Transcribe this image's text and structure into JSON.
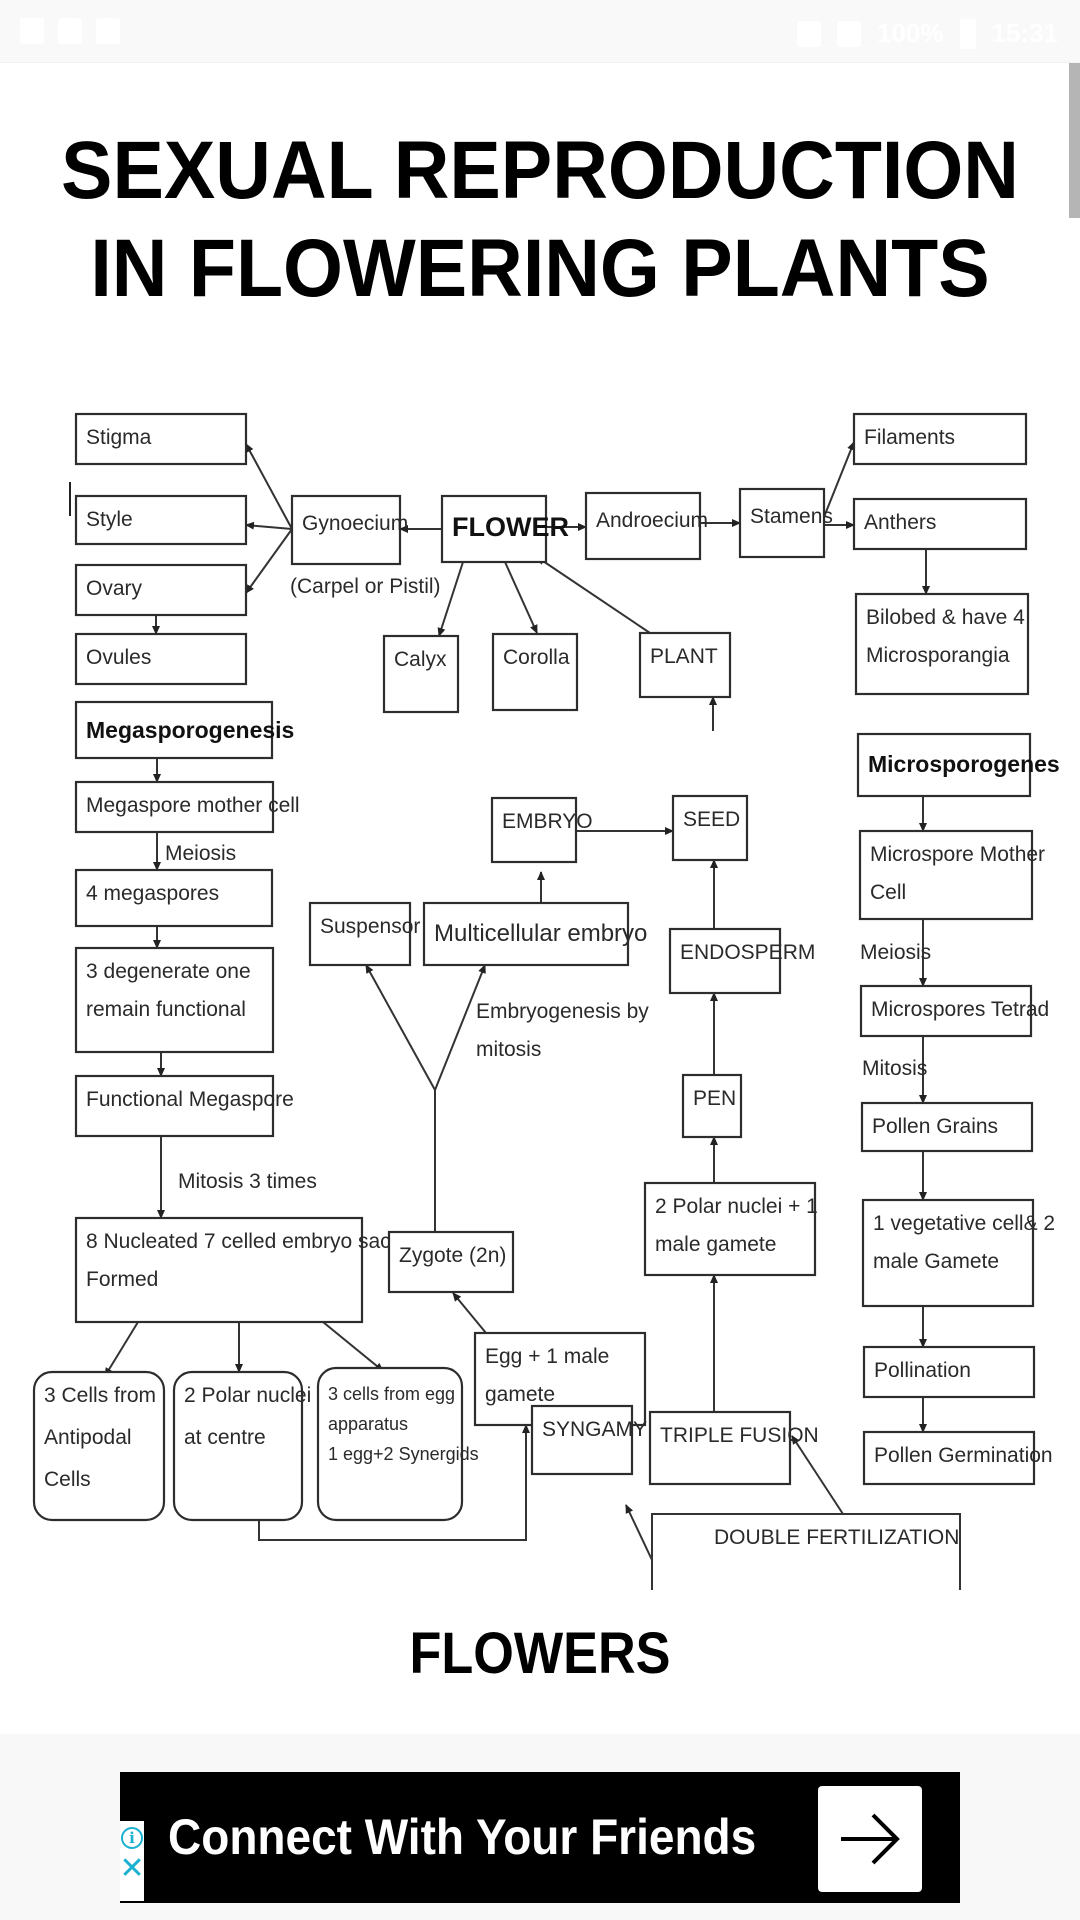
{
  "status_bar": {
    "battery": "100%",
    "time": "15:31"
  },
  "page": {
    "title_lines": [
      "SEXUAL REPRODUCTION",
      "IN FLOWERING PLANTS"
    ],
    "section_title": "FLOWERS"
  },
  "diagram": {
    "title": "Sexual reproduction in flowering plants flowchart",
    "nodes": [
      {
        "id": "stigma",
        "lines": [
          "Stigma"
        ]
      },
      {
        "id": "style",
        "lines": [
          "Style"
        ]
      },
      {
        "id": "ovary",
        "lines": [
          "Ovary"
        ]
      },
      {
        "id": "ovules",
        "lines": [
          "Ovules"
        ]
      },
      {
        "id": "gynoecium",
        "lines": [
          "Gynoecium"
        ]
      },
      {
        "id": "flower",
        "lines": [
          "FLOWER"
        ]
      },
      {
        "id": "androecium",
        "lines": [
          "Androecium"
        ]
      },
      {
        "id": "stamens",
        "lines": [
          "Stamens"
        ]
      },
      {
        "id": "filaments",
        "lines": [
          "Filaments"
        ]
      },
      {
        "id": "anthers",
        "lines": [
          "Anthers"
        ]
      },
      {
        "id": "bilobed",
        "lines": [
          "Bilobed & have 4",
          "Microsporangia"
        ]
      },
      {
        "id": "calyx",
        "lines": [
          "Calyx"
        ]
      },
      {
        "id": "corolla",
        "lines": [
          "Corolla"
        ]
      },
      {
        "id": "plant",
        "lines": [
          "PLANT"
        ]
      },
      {
        "id": "megasporogenesis",
        "lines": [
          "Megasporogenesis"
        ]
      },
      {
        "id": "megaspore_mother_cell",
        "lines": [
          "Megaspore mother cell"
        ]
      },
      {
        "id": "four_megaspores",
        "lines": [
          "4 megaspores"
        ]
      },
      {
        "id": "three_degenerate",
        "lines": [
          "3 degenerate one",
          "remain functional"
        ]
      },
      {
        "id": "functional_megaspore",
        "lines": [
          "Functional Megaspore"
        ]
      },
      {
        "id": "embryo_sac",
        "lines": [
          "8 Nucleated 7 celled embryo sac",
          "Formed"
        ]
      },
      {
        "id": "antipodal",
        "lines": [
          "3 Cells from",
          "Antipodal",
          "Cells"
        ]
      },
      {
        "id": "polar_centre",
        "lines": [
          "2 Polar nuclei",
          "at centre"
        ]
      },
      {
        "id": "egg_apparatus",
        "lines": [
          "3 cells from egg",
          "apparatus",
          "1 egg+2 Synergids"
        ]
      },
      {
        "id": "embryo",
        "lines": [
          "EMBRYO"
        ]
      },
      {
        "id": "seed",
        "lines": [
          "SEED"
        ]
      },
      {
        "id": "suspensor",
        "lines": [
          "Suspensor"
        ]
      },
      {
        "id": "multicellular_embryo",
        "lines": [
          "Multicellular embryo"
        ]
      },
      {
        "id": "endosperm",
        "lines": [
          "ENDOSPERM"
        ]
      },
      {
        "id": "pen",
        "lines": [
          "PEN"
        ]
      },
      {
        "id": "polar_male",
        "lines": [
          "2 Polar nuclei + 1",
          "male gamete"
        ]
      },
      {
        "id": "zygote",
        "lines": [
          "Zygote (2n)"
        ]
      },
      {
        "id": "egg_male",
        "lines": [
          "Egg + 1 male",
          "gamete"
        ]
      },
      {
        "id": "syngamy",
        "lines": [
          "SYNGAMY"
        ]
      },
      {
        "id": "triple_fusion",
        "lines": [
          "TRIPLE FUSION"
        ]
      },
      {
        "id": "double_fertilization",
        "lines": [
          "DOUBLE FERTILIZATION"
        ]
      },
      {
        "id": "microsporogenes",
        "lines": [
          "Microsporogenes"
        ]
      },
      {
        "id": "microspore_mother_cell",
        "lines": [
          "Microspore Mother",
          "Cell"
        ]
      },
      {
        "id": "microspores_tetrad",
        "lines": [
          "Microspores Tetrad"
        ]
      },
      {
        "id": "pollen_grains",
        "lines": [
          "Pollen Grains"
        ]
      },
      {
        "id": "vegetative_cell",
        "lines": [
          "1 vegetative cell& 2",
          "male Gamete"
        ]
      },
      {
        "id": "pollination",
        "lines": [
          "Pollination"
        ]
      },
      {
        "id": "pollen_germination",
        "lines": [
          "Pollen Germination"
        ]
      }
    ],
    "annotations": {
      "carpel": "(Carpel or Pistil)",
      "meiosis_left": "Meiosis",
      "mitosis_3_times": "Mitosis 3 times",
      "embryogenesis_1": "Embryogenesis by",
      "embryogenesis_2": "mitosis",
      "meiosis_right": "Meiosis",
      "mitosis_right": "Mitosis"
    },
    "edges": [
      {
        "from": "flower",
        "to": "gynoecium"
      },
      {
        "from": "gynoecium",
        "to": "stigma"
      },
      {
        "from": "gynoecium",
        "to": "style"
      },
      {
        "from": "gynoecium",
        "to": "ovary"
      },
      {
        "from": "ovary",
        "to": "ovules"
      },
      {
        "from": "flower",
        "to": "androecium"
      },
      {
        "from": "androecium",
        "to": "stamens"
      },
      {
        "from": "stamens",
        "to": "filaments"
      },
      {
        "from": "stamens",
        "to": "anthers"
      },
      {
        "from": "anthers",
        "to": "bilobed"
      },
      {
        "from": "flower",
        "to": "calyx"
      },
      {
        "from": "flower",
        "to": "corolla"
      },
      {
        "from": "plant",
        "to": "flower"
      },
      {
        "from": "seed",
        "to": "plant"
      },
      {
        "from": "embryo",
        "to": "seed"
      },
      {
        "from": "endosperm",
        "to": "seed"
      },
      {
        "from": "pen",
        "to": "endosperm"
      },
      {
        "from": "polar_male",
        "to": "pen"
      },
      {
        "from": "triple_fusion",
        "to": "polar_male"
      },
      {
        "from": "multicellular_embryo",
        "to": "embryo"
      },
      {
        "from": "zygote",
        "to": "suspensor"
      },
      {
        "from": "zygote",
        "to": "multicellular_embryo"
      },
      {
        "from": "egg_male",
        "to": "zygote"
      },
      {
        "from": "syngamy",
        "to": "egg_male"
      },
      {
        "from": "polar_centre",
        "to": "egg_male"
      },
      {
        "from": "double_fertilization",
        "to": "syngamy"
      },
      {
        "from": "double_fertilization",
        "to": "triple_fusion"
      },
      {
        "from": "megasporogenesis",
        "to": "megaspore_mother_cell"
      },
      {
        "from": "megaspore_mother_cell",
        "to": "four_megaspores"
      },
      {
        "from": "four_megaspores",
        "to": "three_degenerate"
      },
      {
        "from": "three_degenerate",
        "to": "functional_megaspore"
      },
      {
        "from": "functional_megaspore",
        "to": "embryo_sac"
      },
      {
        "from": "embryo_sac",
        "to": "antipodal"
      },
      {
        "from": "embryo_sac",
        "to": "polar_centre"
      },
      {
        "from": "embryo_sac",
        "to": "egg_apparatus"
      },
      {
        "from": "microsporogenes",
        "to": "microspore_mother_cell"
      },
      {
        "from": "microspore_mother_cell",
        "to": "microspores_tetrad"
      },
      {
        "from": "microspores_tetrad",
        "to": "pollen_grains"
      },
      {
        "from": "pollen_grains",
        "to": "vegetative_cell"
      },
      {
        "from": "vegetative_cell",
        "to": "pollination"
      },
      {
        "from": "pollination",
        "to": "pollen_germination"
      }
    ]
  },
  "ad": {
    "headline": "Connect With Your Friends",
    "info_icon": "i",
    "close_icon": "✕",
    "cta_icon": "arrow-right"
  }
}
